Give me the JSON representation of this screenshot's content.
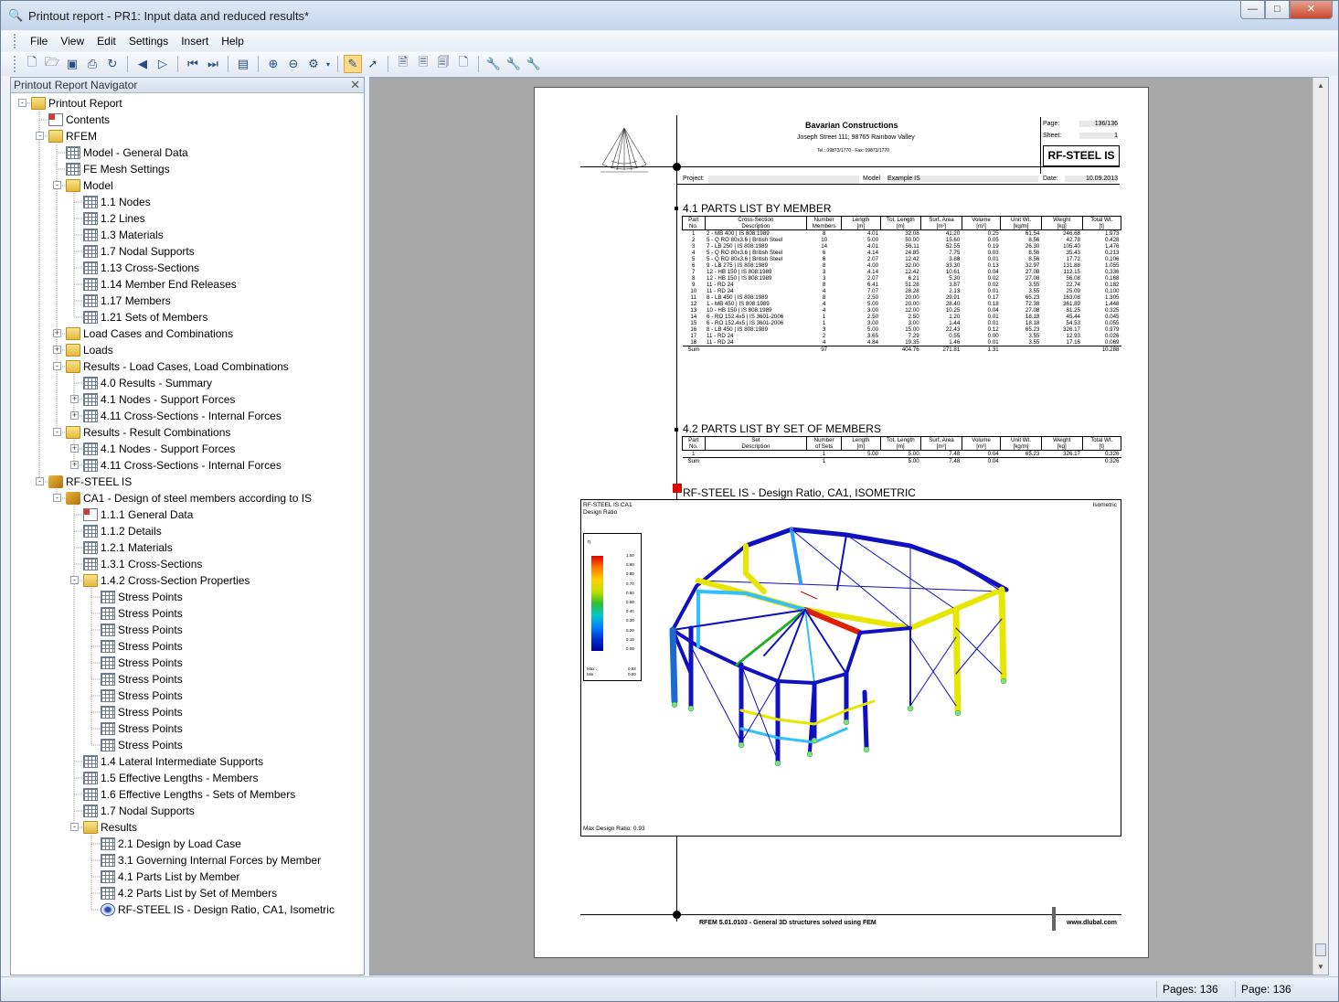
{
  "window": {
    "title": "Printout report - PR1: Input data and reduced results*"
  },
  "menu": [
    "File",
    "View",
    "Edit",
    "Settings",
    "Insert",
    "Help"
  ],
  "navigator": {
    "title": "Printout Report Navigator",
    "items": [
      {
        "label": "Printout Report",
        "depth": 0,
        "icon": "folder",
        "exp": "-"
      },
      {
        "label": "Contents",
        "depth": 1,
        "icon": "doc",
        "exp": ""
      },
      {
        "label": "RFEM",
        "depth": 1,
        "icon": "folder",
        "exp": "-"
      },
      {
        "label": "Model - General Data",
        "depth": 2,
        "icon": "sheet",
        "exp": ""
      },
      {
        "label": "FE Mesh Settings",
        "depth": 2,
        "icon": "sheet",
        "exp": ""
      },
      {
        "label": "Model",
        "depth": 2,
        "icon": "folder",
        "exp": "-"
      },
      {
        "label": "1.1 Nodes",
        "depth": 3,
        "icon": "sheet",
        "exp": ""
      },
      {
        "label": "1.2 Lines",
        "depth": 3,
        "icon": "sheet",
        "exp": ""
      },
      {
        "label": "1.3 Materials",
        "depth": 3,
        "icon": "sheet",
        "exp": ""
      },
      {
        "label": "1.7 Nodal Supports",
        "depth": 3,
        "icon": "sheet",
        "exp": ""
      },
      {
        "label": "1.13 Cross-Sections",
        "depth": 3,
        "icon": "sheet",
        "exp": ""
      },
      {
        "label": "1.14 Member End Releases",
        "depth": 3,
        "icon": "sheet",
        "exp": ""
      },
      {
        "label": "1.17 Members",
        "depth": 3,
        "icon": "sheet",
        "exp": ""
      },
      {
        "label": "1.21 Sets of Members",
        "depth": 3,
        "icon": "sheet",
        "exp": ""
      },
      {
        "label": "Load Cases and Combinations",
        "depth": 2,
        "icon": "folder",
        "exp": "+"
      },
      {
        "label": "Loads",
        "depth": 2,
        "icon": "folder",
        "exp": "+"
      },
      {
        "label": "Results - Load Cases, Load Combinations",
        "depth": 2,
        "icon": "folder",
        "exp": "-"
      },
      {
        "label": "4.0 Results - Summary",
        "depth": 3,
        "icon": "sheet",
        "exp": ""
      },
      {
        "label": "4.1 Nodes - Support Forces",
        "depth": 3,
        "icon": "sheet",
        "exp": "+"
      },
      {
        "label": "4.11 Cross-Sections - Internal Forces",
        "depth": 3,
        "icon": "sheet",
        "exp": "+"
      },
      {
        "label": "Results - Result Combinations",
        "depth": 2,
        "icon": "folder",
        "exp": "-"
      },
      {
        "label": "4.1 Nodes - Support Forces",
        "depth": 3,
        "icon": "sheet",
        "exp": "+"
      },
      {
        "label": "4.11 Cross-Sections - Internal Forces",
        "depth": 3,
        "icon": "sheet",
        "exp": "+"
      },
      {
        "label": "RF-STEEL IS",
        "depth": 1,
        "icon": "mod",
        "exp": "-"
      },
      {
        "label": "CA1 - Design of steel members according to IS",
        "depth": 2,
        "icon": "mod",
        "exp": "-"
      },
      {
        "label": "1.1.1 General Data",
        "depth": 3,
        "icon": "doc",
        "exp": ""
      },
      {
        "label": "1.1.2 Details",
        "depth": 3,
        "icon": "sheet",
        "exp": ""
      },
      {
        "label": "1.2.1 Materials",
        "depth": 3,
        "icon": "sheet",
        "exp": ""
      },
      {
        "label": "1.3.1 Cross-Sections",
        "depth": 3,
        "icon": "sheet",
        "exp": ""
      },
      {
        "label": "1.4.2 Cross-Section Properties",
        "depth": 3,
        "icon": "folder",
        "exp": "-"
      },
      {
        "label": "Stress Points",
        "depth": 4,
        "icon": "sheet",
        "exp": ""
      },
      {
        "label": "Stress Points",
        "depth": 4,
        "icon": "sheet",
        "exp": ""
      },
      {
        "label": "Stress Points",
        "depth": 4,
        "icon": "sheet",
        "exp": ""
      },
      {
        "label": "Stress Points",
        "depth": 4,
        "icon": "sheet",
        "exp": ""
      },
      {
        "label": "Stress Points",
        "depth": 4,
        "icon": "sheet",
        "exp": ""
      },
      {
        "label": "Stress Points",
        "depth": 4,
        "icon": "sheet",
        "exp": ""
      },
      {
        "label": "Stress Points",
        "depth": 4,
        "icon": "sheet",
        "exp": ""
      },
      {
        "label": "Stress Points",
        "depth": 4,
        "icon": "sheet",
        "exp": ""
      },
      {
        "label": "Stress Points",
        "depth": 4,
        "icon": "sheet",
        "exp": ""
      },
      {
        "label": "Stress Points",
        "depth": 4,
        "icon": "sheet",
        "exp": ""
      },
      {
        "label": "1.4 Lateral Intermediate Supports",
        "depth": 3,
        "icon": "sheet",
        "exp": ""
      },
      {
        "label": "1.5 Effective Lengths - Members",
        "depth": 3,
        "icon": "sheet",
        "exp": ""
      },
      {
        "label": "1.6 Effective Lengths - Sets of Members",
        "depth": 3,
        "icon": "sheet",
        "exp": ""
      },
      {
        "label": "1.7 Nodal Supports",
        "depth": 3,
        "icon": "sheet",
        "exp": ""
      },
      {
        "label": "Results",
        "depth": 3,
        "icon": "folder",
        "exp": "-"
      },
      {
        "label": "2.1 Design by Load Case",
        "depth": 4,
        "icon": "sheet",
        "exp": ""
      },
      {
        "label": "3.1 Governing Internal Forces by Member",
        "depth": 4,
        "icon": "sheet",
        "exp": ""
      },
      {
        "label": "4.1 Parts List by Member",
        "depth": 4,
        "icon": "sheet",
        "exp": ""
      },
      {
        "label": "4.2 Parts List by Set of Members",
        "depth": 4,
        "icon": "sheet",
        "exp": ""
      },
      {
        "label": "RF-STEEL IS -  Design Ratio, CA1, Isometric",
        "depth": 4,
        "icon": "eye",
        "exp": ""
      }
    ]
  },
  "page": {
    "company": "Bavarian Constructions",
    "address": "Joseph Street 111; 98765 Rainbow Valley",
    "phone": "Tel.: 09873/1770 - Fax: 09873/1770",
    "page_label": "Page:",
    "page_value": "136/136",
    "sheet_label": "Sheet:",
    "sheet_value": "1",
    "module": "RF-STEEL IS",
    "project_label": "Project:",
    "model_label": "Model",
    "model_value": "Example IS",
    "date_label": "Date:",
    "date_value": "10.09.2013",
    "section1": "4.1 PARTS LIST BY MEMBER",
    "section2": "4.2 PARTS LIST BY SET OF MEMBERS",
    "section3": "RF-STEEL IS -  Design Ratio, CA1, ISOMETRIC",
    "t1_headers": [
      "Part\nNo.",
      "Cross-Section\nDescription",
      "Number\nMembers",
      "Length\n[m]",
      "Tot. Length\n[m]",
      "Surf. Area\n[m²]",
      "Volume\n[m³]",
      "Unit Wt.\n[kg/m]",
      "Weight\n[kg]",
      "Total Wt.\n[t]"
    ],
    "t1_rows": [
      [
        "1",
        "2 - MB 400 | IS 808:1989",
        "8",
        "4.01",
        "32.08",
        "41.20",
        "0.25",
        "61.54",
        "246.68",
        "1.973"
      ],
      [
        "2",
        "5 - Q RO 80x3.6 | British Steel",
        "10",
        "5.00",
        "50.00",
        "15.60",
        "0.05",
        "8.56",
        "42.78",
        "0.428"
      ],
      [
        "3",
        "7 - LB 250 | IS 808:1989",
        "14",
        "4.01",
        "56.11",
        "52.55",
        "0.19",
        "26.30",
        "105.40",
        "1.476"
      ],
      [
        "4",
        "5 - Q RO 80x3.6 | British Steel",
        "6",
        "4.14",
        "24.85",
        "7.75",
        "0.03",
        "8.56",
        "35.43",
        "0.213"
      ],
      [
        "5",
        "5 - Q RO 80x3.6 | British Steel",
        "6",
        "2.07",
        "12.42",
        "3.88",
        "0.01",
        "8.56",
        "17.72",
        "0.106"
      ],
      [
        "6",
        "9 - LB 275 | IS 808:1989",
        "8",
        "4.00",
        "32.00",
        "33.30",
        "0.13",
        "32.97",
        "131.88",
        "1.055"
      ],
      [
        "7",
        "12 - HB 150 | IS 808:1989",
        "3",
        "4.14",
        "12.42",
        "10.61",
        "0.04",
        "27.08",
        "112.15",
        "0.336"
      ],
      [
        "8",
        "12 - HB 150 | IS 808:1989",
        "3",
        "2.07",
        "6.21",
        "5.30",
        "0.02",
        "27.08",
        "56.08",
        "0.168"
      ],
      [
        "9",
        "11 - RD 24",
        "8",
        "6.41",
        "51.28",
        "3.87",
        "0.02",
        "3.55",
        "22.74",
        "0.182"
      ],
      [
        "10",
        "11 - RD 24",
        "4",
        "7.07",
        "28.28",
        "2.13",
        "0.01",
        "3.55",
        "25.09",
        "0.100"
      ],
      [
        "11",
        "8 - LB 450 | IS 808:1989",
        "8",
        "2.50",
        "20.00",
        "29.91",
        "0.17",
        "65.23",
        "163.08",
        "1.305"
      ],
      [
        "12",
        "1 - MB 450 | IS 808:1989",
        "4",
        "5.00",
        "20.00",
        "28.40",
        "0.18",
        "72.38",
        "361.89",
        "1.448"
      ],
      [
        "13",
        "10 - HB 150 | IS 808:1989",
        "4",
        "3.00",
        "12.00",
        "10.25",
        "0.04",
        "27.08",
        "81.25",
        "0.325"
      ],
      [
        "14",
        "6 - RO 152.4x5 | IS 3601-2006",
        "1",
        "2.50",
        "2.50",
        "1.20",
        "0.01",
        "18.18",
        "45.44",
        "0.045"
      ],
      [
        "15",
        "6 - RO 152.4x5 | IS 3601-2006",
        "1",
        "3.00",
        "3.00",
        "1.44",
        "0.01",
        "18.18",
        "54.53",
        "0.055"
      ],
      [
        "16",
        "8 - LB 450 | IS 808:1989",
        "3",
        "5.00",
        "15.00",
        "22.43",
        "0.12",
        "65.23",
        "326.17",
        "0.979"
      ],
      [
        "17",
        "11 - RD 24",
        "2",
        "3.65",
        "7.29",
        "0.55",
        "0.00",
        "3.55",
        "12.93",
        "0.026"
      ],
      [
        "18",
        "11 - RD 24",
        "4",
        "4.84",
        "19.35",
        "1.46",
        "0.01",
        "3.55",
        "17.16",
        "0.069"
      ]
    ],
    "t1_sum": [
      "Sum",
      "",
      "97",
      "",
      "404.76",
      "271.81",
      "1.31",
      "",
      "",
      "10.288"
    ],
    "t2_headers": [
      "Part\nNo.",
      "Set\nDescription",
      "Number\nof Sets",
      "Length\n[m]",
      "Tot. Length\n[m]",
      "Surf. Area\n[m²]",
      "Volume\n[m³]",
      "Unit Wt.\n[kg/m]",
      "Weight\n[kg]",
      "Total Wt.\n[t]"
    ],
    "t2_rows": [
      [
        "1",
        "",
        "1",
        "5.00",
        "5.00",
        "7.48",
        "0.04",
        "65.23",
        "326.17",
        "0.326"
      ]
    ],
    "t2_sum": [
      "Sum",
      "",
      "1",
      "",
      "5.00",
      "7.48",
      "0.04",
      "",
      "",
      "0.326"
    ],
    "fig_title1": "RF-STEEL IS CA1",
    "fig_title2": "Design Ratio",
    "fig_view": "Isometric",
    "legend_head": "η",
    "legend_ticks": [
      "1.00",
      "0.90",
      "0.80",
      "0.70",
      "0.60",
      "0.50",
      "0.40",
      "0.30",
      "0.20",
      "0.10",
      "0.00"
    ],
    "legend_max": "Max :",
    "legend_max_v": "0.93",
    "legend_min": "Min :",
    "legend_min_v": "0.00",
    "fig_foot": "Max Design Ratio: 0.93",
    "footer_left": "RFEM 5.01.0103 - General 3D structures solved using FEM",
    "footer_right": "www.dlubal.com"
  },
  "status": {
    "pages": "Pages: 136",
    "page": "Page: 136"
  }
}
